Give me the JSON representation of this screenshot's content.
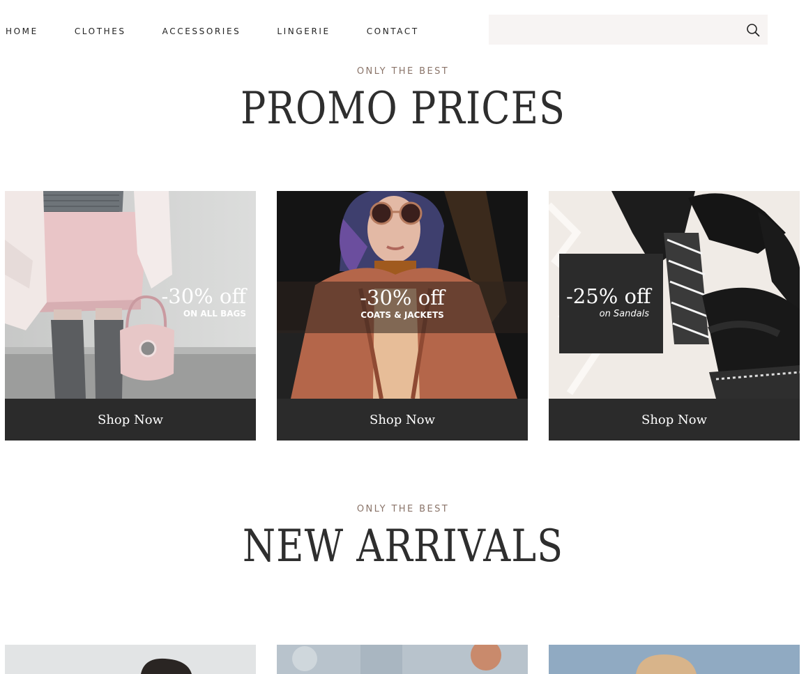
{
  "nav": {
    "items": [
      {
        "label": "HOME"
      },
      {
        "label": "CLOTHES"
      },
      {
        "label": "ACCESSORIES"
      },
      {
        "label": "LINGERIE"
      },
      {
        "label": "CONTACT"
      }
    ],
    "search": {
      "placeholder": "",
      "value": "",
      "icon": "search-icon"
    }
  },
  "promo_section": {
    "eyebrow": "ONLY THE BEST",
    "title": "PROMO PRICES",
    "cards": [
      {
        "discount": "-30% off",
        "subtitle": "ON ALL BAGS",
        "button": "Shop Now"
      },
      {
        "discount": "-30% off",
        "subtitle": "COATS & JACKETS",
        "button": "Shop Now"
      },
      {
        "discount": "-25% off",
        "subtitle": "on Sandals",
        "button": "Shop Now"
      }
    ]
  },
  "arrivals_section": {
    "eyebrow": "ONLY THE BEST",
    "title": "NEW ARRIVALS"
  },
  "colors": {
    "accent_eyebrow": "#8a7469",
    "button_bg": "#2b2b2b",
    "search_bg": "#f7f4f3"
  }
}
